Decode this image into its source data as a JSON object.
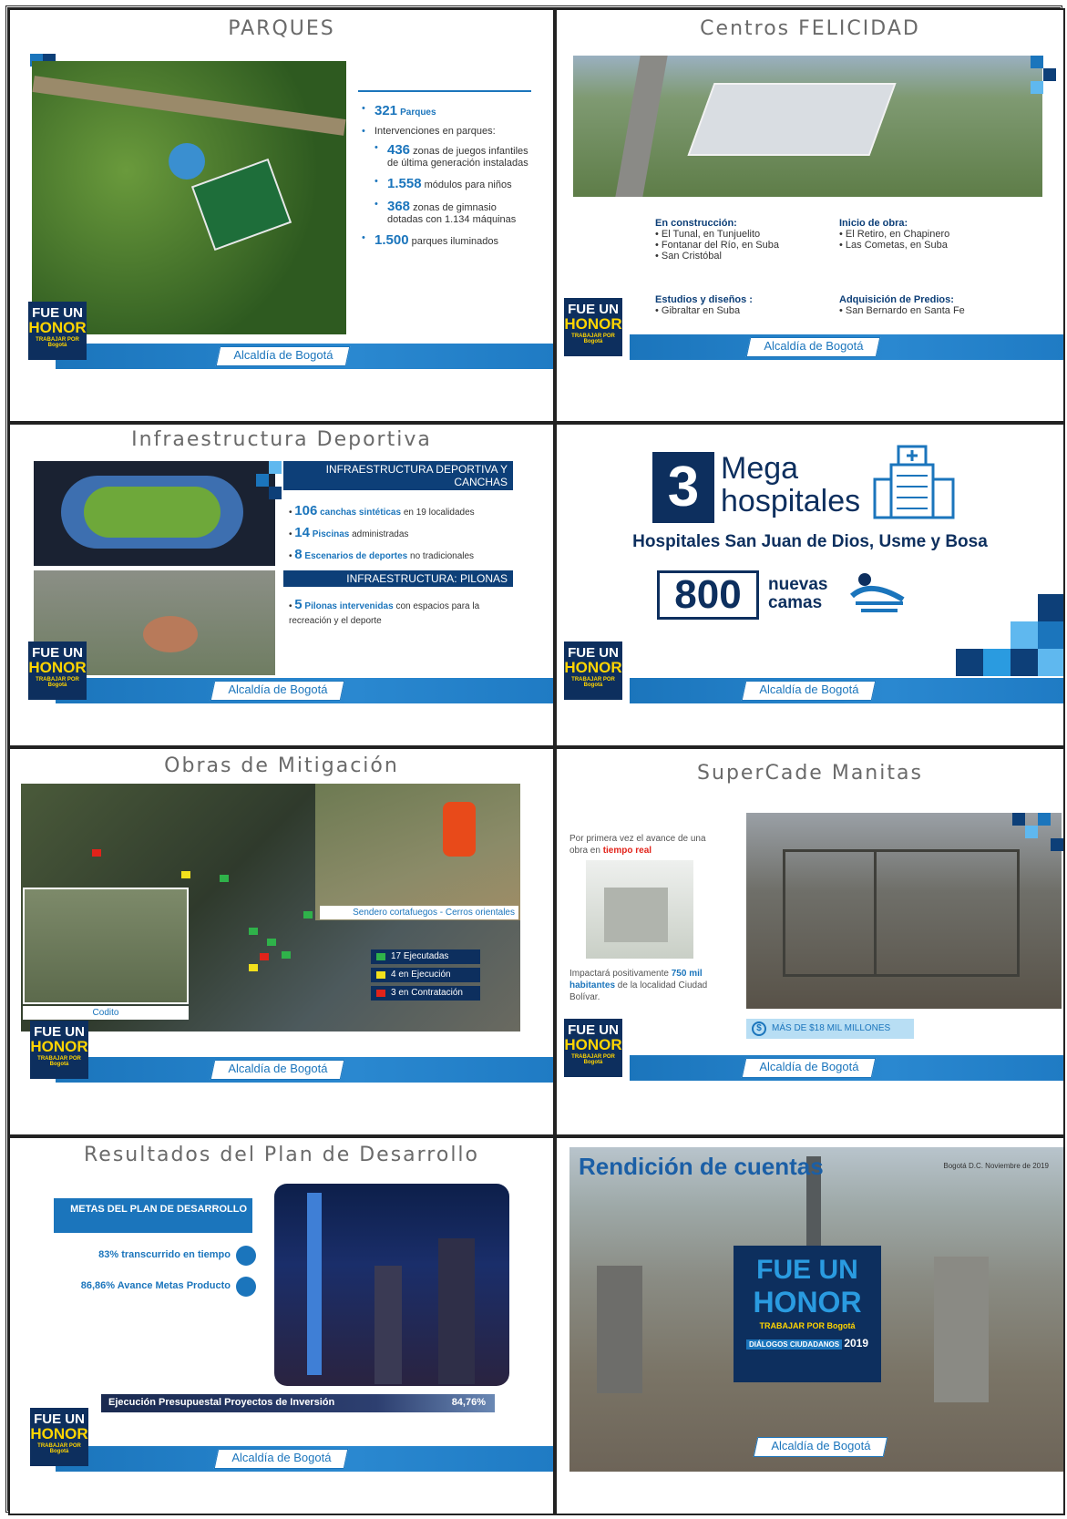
{
  "common": {
    "footer_label": "Alcaldía de Bogotá",
    "badge_line1": "FUE UN",
    "badge_line2": "HONOR",
    "badge_line3": "TRABAJAR POR Bogotá"
  },
  "parques": {
    "title": "PARQUES",
    "b1_num": "321",
    "b1_text": "Parques",
    "b2_text": "Intervenciones en parques:",
    "b2a_num": "436",
    "b2a_text": "zonas de juegos infantiles de última generación instaladas",
    "b2b_num": "1.558",
    "b2b_text": "módulos para niños",
    "b2c_num": "368",
    "b2c_text": "zonas de gimnasio dotadas con 1.134 máquinas",
    "b3_num": "1.500",
    "b3_text": "parques iluminados"
  },
  "felicidad": {
    "title": "Centros FELICIDAD",
    "construccion_h": "En construcción:",
    "construccion_items": [
      "El Tunal, en Tunjuelito",
      "Fontanar del Río, en Suba",
      "San Cristóbal"
    ],
    "inicio_h": "Inicio de obra:",
    "inicio_items": [
      "El Retiro, en Chapinero",
      "Las Cometas, en Suba"
    ],
    "estudios_h": "Estudios y diseños :",
    "estudios_items": [
      "Gibraltar en Suba"
    ],
    "predios_h": "Adquisición de Predios:",
    "predios_items": [
      "San Bernardo en Santa Fe"
    ]
  },
  "deportiva": {
    "title": "Infraestructura Deportiva",
    "sec1": "INFRAESTRUCTURA DEPORTIVA Y CANCHAS",
    "i1_num": "106",
    "i1_bold": "canchas sintéticas",
    "i1_text": "en 19 localidades",
    "i2_num": "14",
    "i2_bold": "Piscinas",
    "i2_text": "administradas",
    "i3_num": "8",
    "i3_bold": "Escenarios de deportes",
    "i3_text": "no tradicionales",
    "sec2": "INFRAESTRUCTURA: PILONAS",
    "i4_num": "5",
    "i4_bold": "Pilonas intervenidas",
    "i4_text": "con espacios para la recreación y el deporte"
  },
  "hospitales": {
    "big_num": "3",
    "mega": "Mega",
    "hosp": "hospitales",
    "subtitle": "Hospitales San Juan de Dios, Usme y Bosa",
    "beds_num": "800",
    "beds_l1": "nuevas",
    "beds_l2": "camas"
  },
  "mitigacion": {
    "title": "Obras de Mitigación",
    "caption_right": "Sendero cortafuegos - Cerros orientales",
    "caption_left": "Codito",
    "legend": [
      {
        "label": "17 Ejecutadas",
        "color": "#2fb24a"
      },
      {
        "label": "4 en Ejecución",
        "color": "#f2e01c"
      },
      {
        "label": "3 en Contratación",
        "color": "#e2231a"
      }
    ]
  },
  "supercade": {
    "title": "SuperCade Manitas",
    "text1_a": "Por primera vez el avance de una obra en",
    "text1_b": "tiempo real",
    "text2_a": "Impactará positivamente",
    "text2_b": "750 mil habitantes",
    "text2_c": "de la localidad Ciudad Bolívar.",
    "money": "MÁS DE $18 MIL MILLONES"
  },
  "plan": {
    "title": "Resultados del Plan de Desarrollo",
    "metas": "METAS DEL PLAN DE DESARROLLO",
    "m1": "83% transcurrido en tiempo",
    "m2": "86,86% Avance Metas Producto",
    "ejec_label": "Ejecución Presupuestal Proyectos de Inversión",
    "ejec_value": "84,76%"
  },
  "rendicion": {
    "title": "Rendición de cuentas",
    "date": "Bogotá D.C. Noviembre de 2019",
    "badge_line1": "FUE UN",
    "badge_line2": "HONOR",
    "badge_line3": "TRABAJAR POR Bogotá",
    "badge_line4": "DIÁLOGOS CIUDADANOS",
    "badge_year": "2019"
  },
  "colors": {
    "brand_blue": "#1b75bc",
    "navy": "#0d2f5e",
    "yellow": "#ffd400"
  }
}
